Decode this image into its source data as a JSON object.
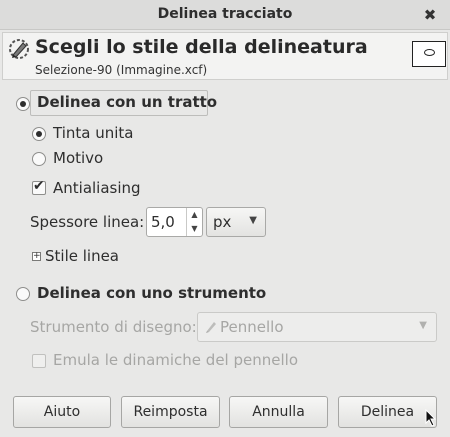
{
  "window": {
    "title": "Delinea tracciato",
    "close_icon": "close-icon"
  },
  "header": {
    "title": "Scegli lo stile della delineatura",
    "subtitle": "Selezione-90 (Immagine.xcf)",
    "icon": "stroke-path-icon"
  },
  "stroke_line": {
    "label": "Delinea con un tratto",
    "selected": true,
    "fill": {
      "solid_label": "Tinta unita",
      "pattern_label": "Motivo",
      "selected": "Tinta unita"
    },
    "antialiasing_label": "Antialiasing",
    "antialiasing_checked": true,
    "line_width_label": "Spessore linea:",
    "line_width_value": "5,0",
    "unit_value": "px",
    "line_style_label": "Stile linea"
  },
  "stroke_tool": {
    "label": "Delinea con uno strumento",
    "selected": false,
    "paint_tool_label": "Strumento di disegno:",
    "paint_tool_value": "Pennello",
    "emulate_label": "Emula le dinamiche del pennello",
    "emulate_checked": false
  },
  "buttons": {
    "help": "Aiuto",
    "reset": "Reimposta",
    "cancel": "Annulla",
    "stroke": "Delinea"
  }
}
